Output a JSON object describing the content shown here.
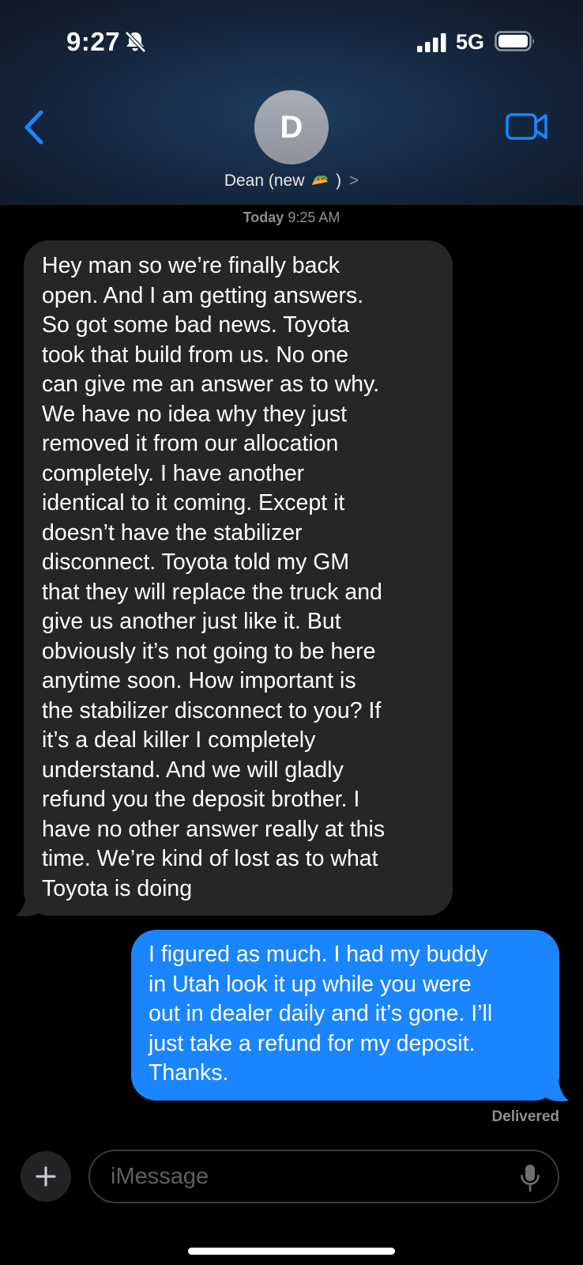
{
  "status_bar": {
    "time": "9:27",
    "network": "5G"
  },
  "header": {
    "avatar_initial": "D",
    "contact_name_prefix": "Dean (new",
    "contact_name_suffix": ")",
    "contact_chevron": ">"
  },
  "conversation": {
    "timestamp_day": "Today",
    "timestamp_time": "9:25 AM",
    "messages": [
      {
        "direction": "incoming",
        "lines": [
          "Hey man so we’re finally back",
          "open. And I am getting answers.",
          "So got some bad news. Toyota",
          "took that build from us. No one",
          "can give me an answer as to why.",
          "We have no idea why they just",
          "removed it from our allocation",
          "completely. I have another",
          "identical to it coming. Except it",
          "doesn’t have the stabilizer",
          "disconnect. Toyota told my GM",
          "that they will replace the truck and",
          "give us another just like it. But",
          "obviously it’s not going to be here",
          "anytime soon. How important is",
          "the stabilizer disconnect to you? If",
          "it’s a deal killer I completely",
          "understand. And we will gladly",
          "refund you the deposit brother. I",
          "have no other answer really at this",
          "time. We’re kind of lost as to what",
          "Toyota is doing"
        ]
      },
      {
        "direction": "outgoing",
        "lines": [
          "I figured as much. I had my buddy",
          "in Utah look it up while you were",
          "out in dealer daily and it’s gone. I’ll",
          "just take a refund for my deposit.",
          "Thanks."
        ],
        "status": "Delivered"
      }
    ]
  },
  "composer": {
    "placeholder": "iMessage"
  },
  "colors": {
    "accent": "#1a85ff",
    "incoming_bubble": "#262628",
    "background": "#000000"
  },
  "icons": [
    "bell-slash-icon",
    "signal-icon",
    "battery-icon",
    "back-chevron-icon",
    "video-camera-icon",
    "taco-emoji",
    "plus-icon",
    "microphone-icon"
  ]
}
